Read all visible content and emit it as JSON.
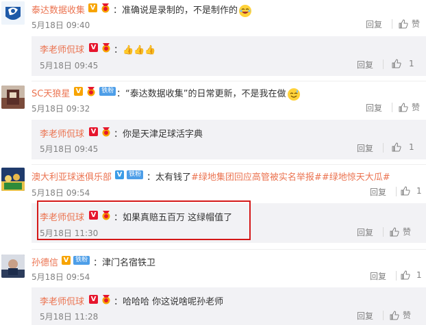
{
  "comments": [
    {
      "name": "泰达数据收集",
      "text": "准确说是录制的，不是制作的",
      "time": "5月18日 09:40",
      "reply_label": "回复",
      "like_label": "赞",
      "badge": "vorange",
      "reply": {
        "name": "李老师侃球",
        "text": "👍👍👍",
        "time": "5月18日 09:45",
        "reply_label": "回复",
        "like_count": "1"
      }
    },
    {
      "name": "SC天狼星",
      "fan_badge": "铁粉",
      "text": "“泰达数据收集”的日常更新，不是我在做",
      "time": "5月18日 09:32",
      "reply_label": "回复",
      "like_label": "赞",
      "reply": {
        "name": "李老师侃球",
        "text": "你是天津足球活字典",
        "time": "5月18日 09:45",
        "reply_label": "回复",
        "like_count": "1"
      }
    },
    {
      "name": "澳大利亚球迷俱乐部",
      "fan_badge": "铁粉",
      "text_prefix": "太有钱了",
      "tags": [
        "#绿地集团回应高管被实名举报#",
        "#绿地惊天大瓜#"
      ],
      "time": "5月18日 09:54",
      "reply_label": "回复",
      "like_count": "1",
      "reply": {
        "name": "李老师侃球",
        "text": "如果真赔五百万 这绿帽值了",
        "time": "5月18日 11:30",
        "reply_label": "回复",
        "like_label": "赞"
      }
    },
    {
      "name": "孙德信",
      "fan_badge": "铁粉",
      "text": "津门名宿铁卫",
      "time": "5月18日 09:54",
      "reply_label": "回复",
      "like_count": "1",
      "reply": {
        "name": "李老师侃球",
        "text": "哈哈哈 你这说啥呢孙老师",
        "time": "5月18日 11:28",
        "reply_label": "回复",
        "like_label": "赞"
      }
    }
  ],
  "colors": {
    "name": "#eb7350",
    "text": "#333333",
    "meta": "#808080",
    "reply_bg": "#f2f2f5",
    "highlight": "#d41717"
  }
}
